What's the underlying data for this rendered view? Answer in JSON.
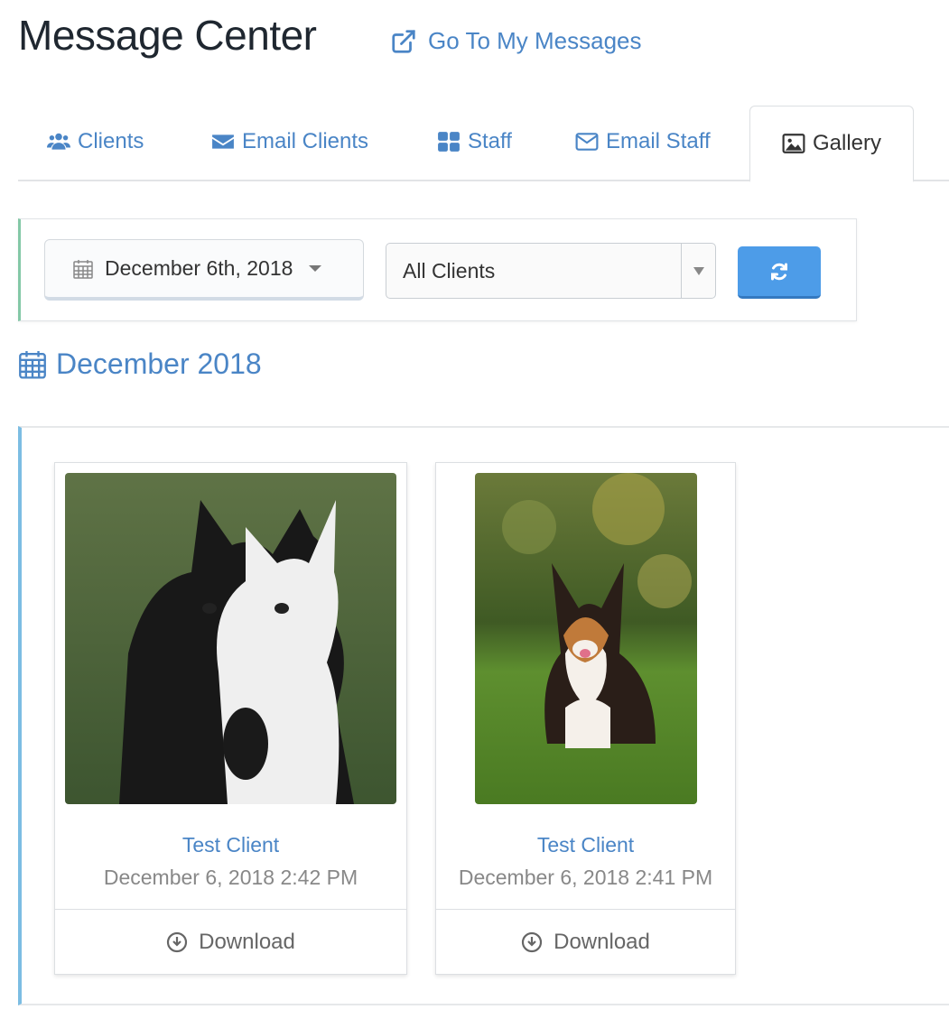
{
  "header": {
    "title": "Message Center",
    "link_label": "Go To My Messages",
    "link_icon": "external-link-icon"
  },
  "tabs": [
    {
      "label": "Clients",
      "icon": "users-icon",
      "active": false
    },
    {
      "label": "Email Clients",
      "icon": "envelope-icon",
      "active": false
    },
    {
      "label": "Staff",
      "icon": "th-large-icon",
      "active": false
    },
    {
      "label": "Email Staff",
      "icon": "envelope-outline-icon",
      "active": false
    },
    {
      "label": "Gallery",
      "icon": "picture-icon",
      "active": true
    }
  ],
  "filters": {
    "date_value": "December 6th, 2018",
    "client_select_value": "All Clients",
    "refresh_icon": "refresh-icon"
  },
  "section": {
    "month_heading": "December 2018"
  },
  "gallery": {
    "items": [
      {
        "client": "Test Client",
        "timestamp": "December 6, 2018 2:42 PM",
        "action_label": "Download",
        "image_desc": "black and white border collies on grass"
      },
      {
        "client": "Test Client",
        "timestamp": "December 6, 2018 2:41 PM",
        "action_label": "Download",
        "image_desc": "corgi sitting on grass"
      }
    ]
  },
  "colors": {
    "link_blue": "#4a85c6",
    "button_blue": "#4d9ce8",
    "filter_accent": "#84c8a7",
    "gallery_accent": "#7cbde3"
  }
}
